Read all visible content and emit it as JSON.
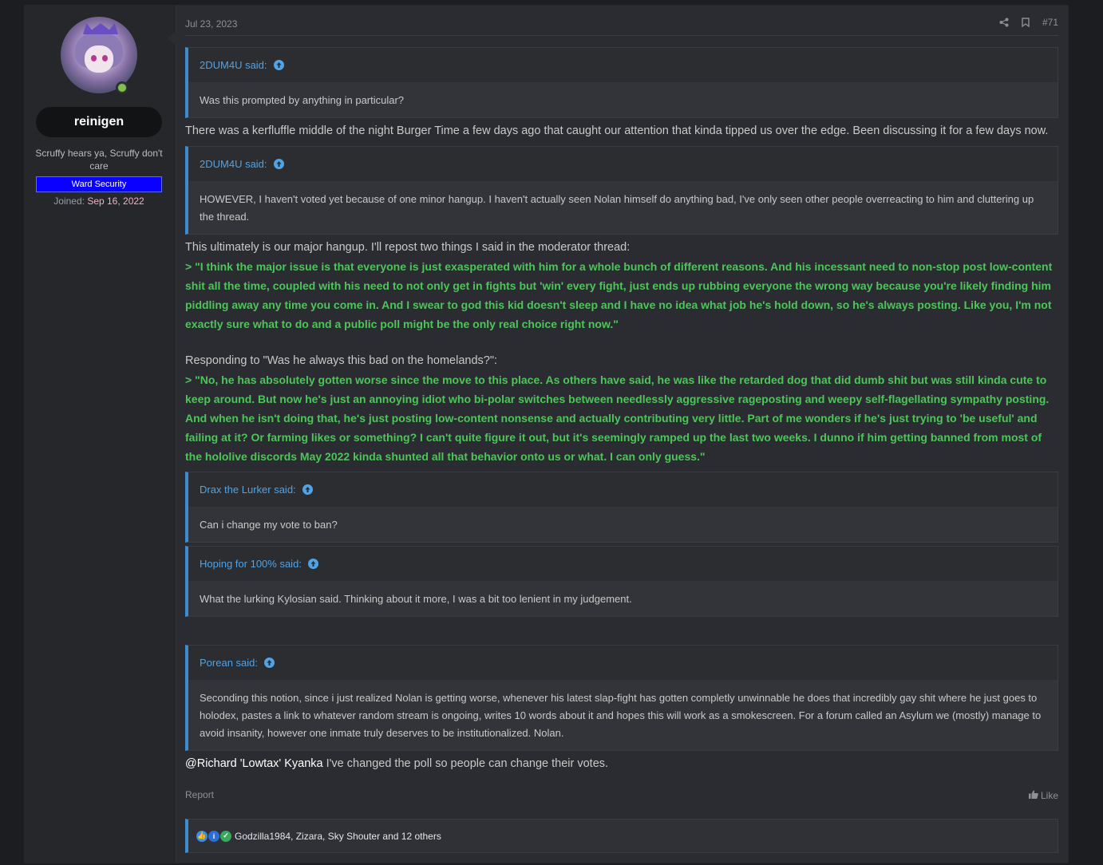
{
  "post": {
    "date": "Jul 23, 2023",
    "number": "#71",
    "user": {
      "name": "reinigen",
      "title": "Scruffy hears ya, Scruffy don't care",
      "banner": "Ward Security",
      "joined_label": "Joined:",
      "joined_date": "Sep 16, 2022"
    },
    "quotes": [
      {
        "author": "2DUM4U said:",
        "body": "Was this prompted by anything in particular?"
      },
      {
        "author": "2DUM4U said:",
        "body": "HOWEVER, I haven't voted yet because of one minor hangup. I haven't actually seen Nolan himself do anything bad, I've only seen other people overreacting to him and cluttering up the thread."
      },
      {
        "author": "Drax the Lurker said:",
        "body": "Can i change my vote to ban?"
      },
      {
        "author": "Hoping for 100% said:",
        "body": "What the lurking Kylosian said. Thinking about it more, I was a bit too lenient in my judgement."
      },
      {
        "author": "Porean said:",
        "body": "Seconding this notion, since i just realized Nolan is getting worse, whenever his latest slap-fight has gotten completly unwinnable he does that incredibly gay shit where he just goes to holodex, pastes a link to whatever random stream is ongoing, writes 10 words about it and hopes this will work as a smokescreen. For a forum called an Asylum we (mostly) manage to avoid insanity, however one inmate truly deserves to be institutionalized. Nolan."
      }
    ],
    "paragraphs": {
      "p1": "There was a kerfluffle middle of the night Burger Time a few days ago that caught our attention that kinda tipped us over the edge. Been discussing it for a few days now.",
      "p2": "This ultimately is our major hangup. I'll repost two things I said in the moderator thread:",
      "g1": "> \"I think the major issue is that everyone is just exasperated with him for a whole bunch of different reasons. And his incessant need to non-stop post low-content shit all the time, coupled with his need to not only get in fights but 'win' every fight, just ends up rubbing everyone the wrong way because you're likely finding him piddling away any time you come in. And I swear to god this kid doesn't sleep and I have no idea what job he's hold down, so he's always posting. Like you, I'm not exactly sure what to do and a public poll might be the only real choice right now.\"",
      "p3": "Responding to \"Was he always this bad on the homelands?\":",
      "g2": "> \"No, he has absolutely gotten worse since the move to this place. As others have said, he was like the retarded dog that did dumb shit but was still kinda cute to keep around. But now he's just an annoying idiot who bi-polar switches between needlessly aggressive rageposting and weepy self-flagellating sympathy posting. And when he isn't doing that, he's just posting low-content nonsense and actually contributing very little. Part of me wonders if he's just trying to 'be useful' and failing at it? Or farming likes or something? I can't quite figure it out, but it's seemingly ramped up the last two weeks. I dunno if him getting banned from most of the hololive discords May 2022 kinda shunted all that behavior onto us or what. I can only guess.\"",
      "mention": "@Richard 'Lowtax' Kyanka",
      "final": " I've changed the poll so people can change their votes."
    },
    "footer": {
      "report": "Report",
      "like": "Like",
      "reactions": "Godzilla1984, Zizara, Sky Shouter and 12 others"
    },
    "colors": {
      "accent": "#3c8dcf",
      "green_quote": "#4ec45a",
      "banner": "#0a00ff",
      "joined_date": "#f0b0c8"
    }
  }
}
